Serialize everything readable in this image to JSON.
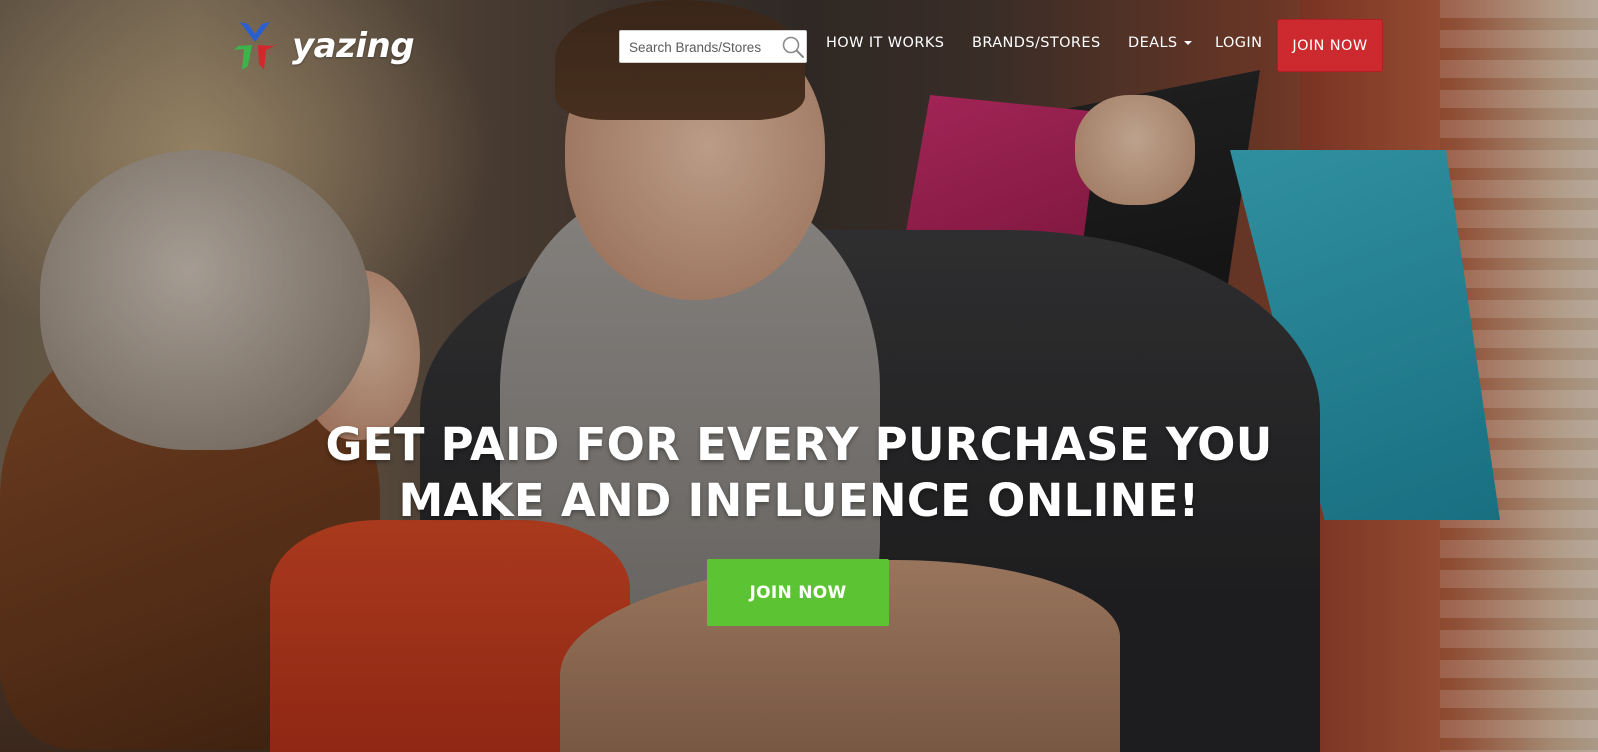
{
  "brand": {
    "name": "yazing"
  },
  "navbar": {
    "search_placeholder": "Search Brands/Stores",
    "links": [
      {
        "label": "HOW IT WORKS"
      },
      {
        "label": "BRANDS/STORES"
      },
      {
        "label": "DEALS"
      },
      {
        "label": "LOGIN"
      }
    ],
    "join_label": "JOIN NOW"
  },
  "hero": {
    "headline_line1": "GET PAID FOR EVERY PURCHASE YOU",
    "headline_line2": "MAKE AND INFLUENCE ONLINE!",
    "cta_label": "JOIN NOW"
  },
  "colors": {
    "join_top_bg": "#cc2a2f",
    "cta_bg": "#5cc433",
    "logo_blue": "#2a5fd0",
    "logo_green": "#39b54a",
    "logo_red": "#d7262b"
  },
  "icons": {
    "search": "search-icon",
    "deals_dropdown": "caret-down-icon"
  }
}
